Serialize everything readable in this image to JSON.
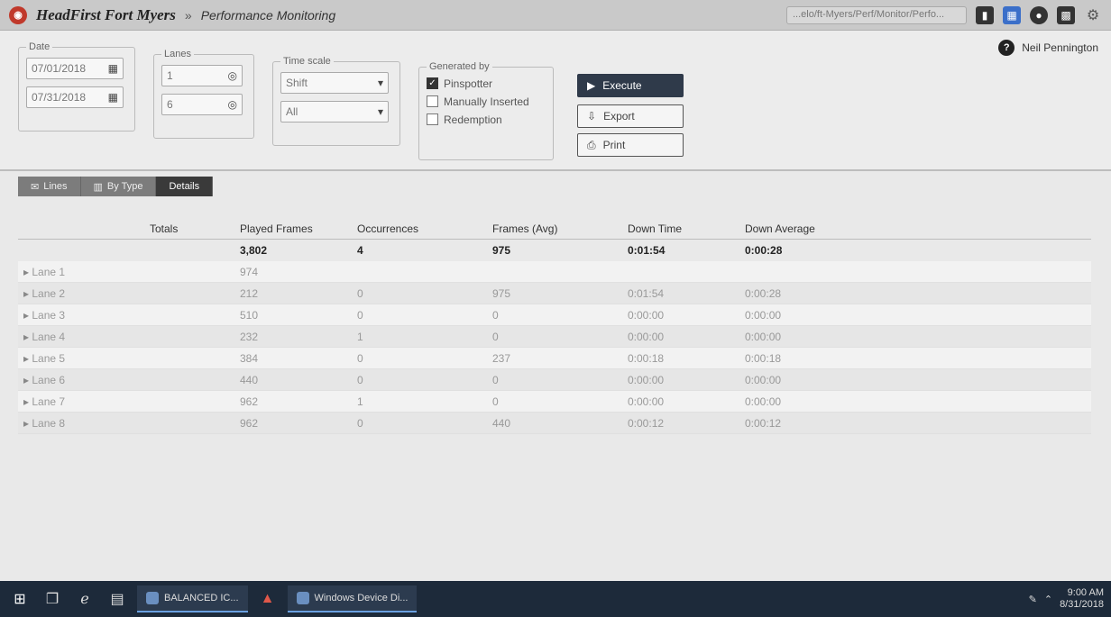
{
  "titlebar": {
    "app_name": "HeadFirst Fort Myers",
    "separator": "»",
    "page": "Performance Monitoring",
    "address": "...elo/ft-Myers/Perf/Monitor/Perfo..."
  },
  "user": {
    "name": "Neil Pennington"
  },
  "filters": {
    "date": {
      "label": "Date",
      "from": "07/01/2018",
      "to": "07/31/2018"
    },
    "lanes": {
      "label": "Lanes",
      "from": "1",
      "to": "6"
    },
    "time_scale": {
      "label": "Time scale",
      "primary": "Shift",
      "secondary": "All"
    },
    "generated_by": {
      "label": "Generated by",
      "options": [
        {
          "label": "Pinspotter",
          "checked": true
        },
        {
          "label": "Manually Inserted",
          "checked": false
        },
        {
          "label": "Redemption",
          "checked": false
        }
      ]
    },
    "buttons": {
      "execute": "Execute",
      "export": "Export",
      "print": "Print"
    }
  },
  "tabs": [
    {
      "label": "Lines",
      "icon": "✉"
    },
    {
      "label": "By Type",
      "icon": "▥"
    },
    {
      "label": "Details",
      "icon": ""
    }
  ],
  "table": {
    "headers": [
      "",
      "Totals",
      "Played Frames",
      "Occurrences",
      "Frames (Avg)",
      "Down Time",
      "Down Average"
    ],
    "totals": [
      "",
      "",
      "3,802",
      "4",
      "975",
      "0:01:54",
      "0:00:28"
    ],
    "rows": [
      [
        "Lane 1",
        "",
        "974",
        "",
        "",
        "",
        ""
      ],
      [
        "Lane 2",
        "",
        "212",
        "0",
        "975",
        "0:01:54",
        "0:00:28"
      ],
      [
        "Lane 3",
        "",
        "510",
        "0",
        "0",
        "0:00:00",
        "0:00:00"
      ],
      [
        "Lane 4",
        "",
        "232",
        "1",
        "0",
        "0:00:00",
        "0:00:00"
      ],
      [
        "Lane 5",
        "",
        "384",
        "0",
        "237",
        "0:00:18",
        "0:00:18"
      ],
      [
        "Lane 6",
        "",
        "440",
        "0",
        "0",
        "0:00:00",
        "0:00:00"
      ],
      [
        "Lane 7",
        "",
        "962",
        "1",
        "0",
        "0:00:00",
        "0:00:00"
      ],
      [
        "Lane 8",
        "",
        "962",
        "0",
        "440",
        "0:00:12",
        "0:00:12"
      ]
    ]
  },
  "taskbar": {
    "apps": [
      {
        "label": "BALANCED IC..."
      },
      {
        "label": "Windows Device Di..."
      }
    ],
    "clock": {
      "time": "9:00 AM",
      "date": "8/31/2018"
    }
  }
}
